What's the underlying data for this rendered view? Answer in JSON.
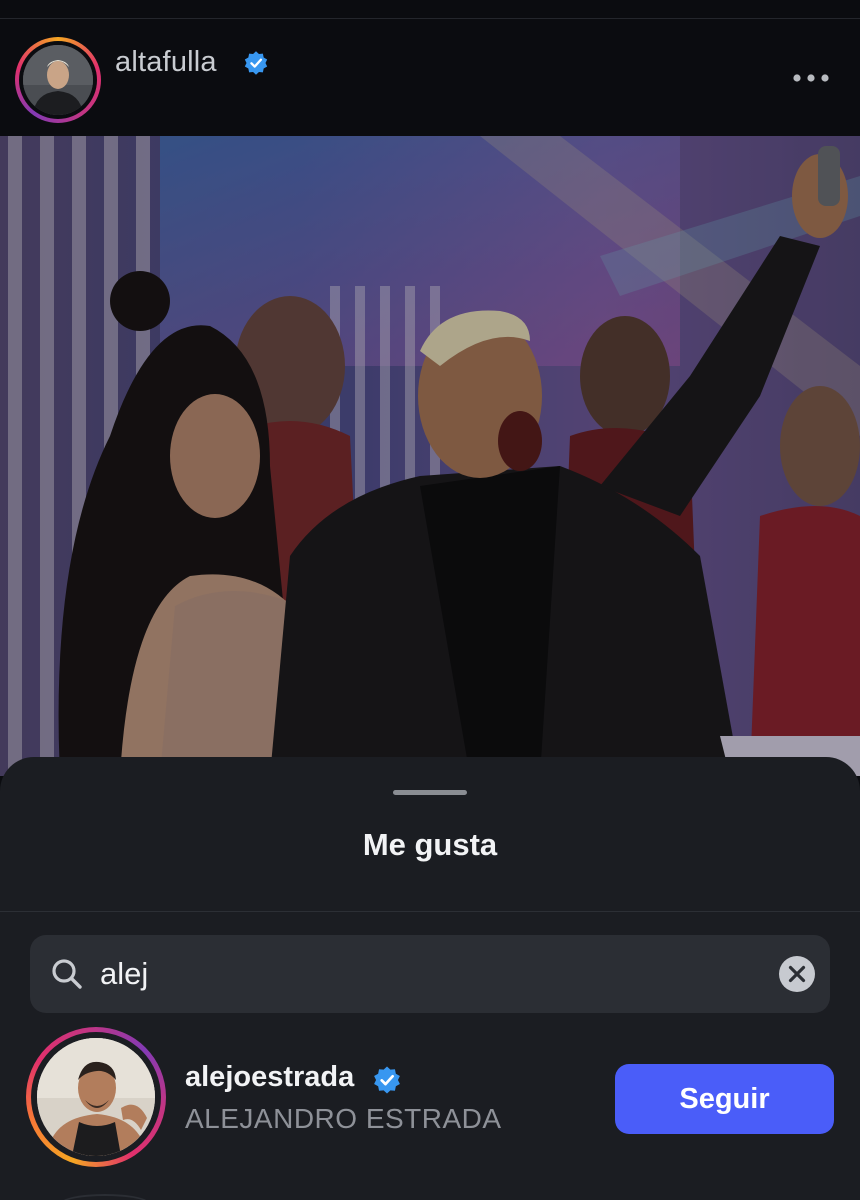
{
  "post": {
    "username": "altafulla",
    "verified": true,
    "more_icon": "more-horizontal-icon"
  },
  "sheet": {
    "title": "Me gusta"
  },
  "search": {
    "value": "alej",
    "icon": "search-icon",
    "clear_icon": "clear-icon"
  },
  "results": [
    {
      "username": "alejoestrada",
      "full_name": "ALEJANDRO ESTRADA",
      "verified": true,
      "button_label": "Seguir"
    }
  ],
  "colors": {
    "background": "#0b0c10",
    "sheet": "#1b1d22",
    "search_field": "#2b2e34",
    "accent_button": "#4a5df9",
    "verified_badge": "#3897f0"
  }
}
